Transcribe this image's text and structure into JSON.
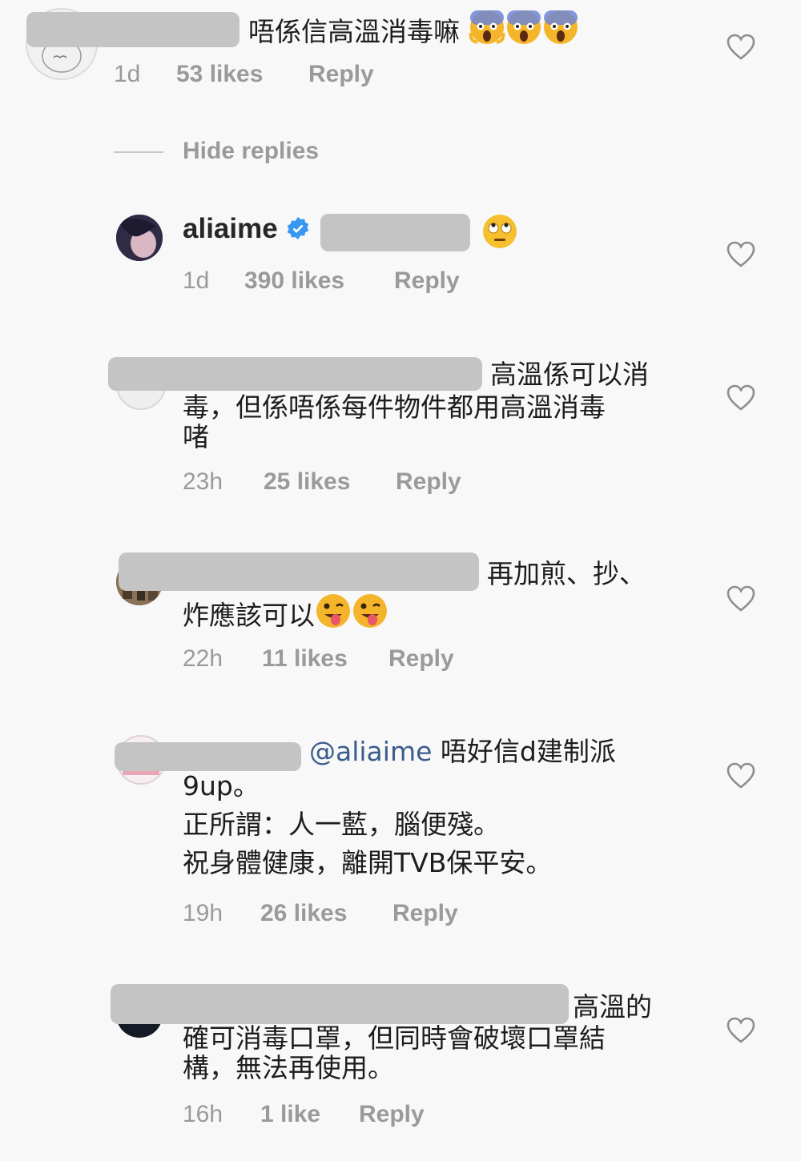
{
  "comments": [
    {
      "text": "唔係信高溫消毒嘛",
      "emoji": [
        "scream-emoji",
        "scream-emoji",
        "scream-emoji"
      ],
      "time": "1d",
      "likes": "53 likes",
      "reply": "Reply"
    },
    {
      "username": "aliaime",
      "verified": true,
      "emoji": [
        "rolling-eyes-emoji"
      ],
      "time": "1d",
      "likes": "390 likes",
      "reply": "Reply"
    },
    {
      "line1": "高溫係可以消",
      "line2": "毒，但係唔係每件物件都用高溫消毒",
      "line3": "啫",
      "time": "23h",
      "likes": "25 likes",
      "reply": "Reply"
    },
    {
      "line1": "再加煎、抄、",
      "line2": "炸應該可以",
      "emoji": [
        "tongue-wink-emoji",
        "tongue-wink-emoji"
      ],
      "time": "22h",
      "likes": "11 likes",
      "reply": "Reply"
    },
    {
      "mention": "@aliaime",
      "line1": "唔好信d建制派",
      "line2": "9up。",
      "line3": "正所謂：人一藍，腦便殘。",
      "line4": "祝身體健康，離開TVB保平安。",
      "time": "19h",
      "likes": "26 likes",
      "reply": "Reply"
    },
    {
      "line1": "高溫的",
      "line2": "確可消毒口罩，但同時會破壞口罩結",
      "line3": "構，無法再使用。",
      "time": "16h",
      "likes": "1 like",
      "reply": "Reply"
    }
  ],
  "hide_replies": "Hide replies",
  "colors": {
    "meta": "#9a9a9a",
    "redaction": "#c4c4c4",
    "mention": "#3b5d8c",
    "verified": "#3897f0"
  }
}
